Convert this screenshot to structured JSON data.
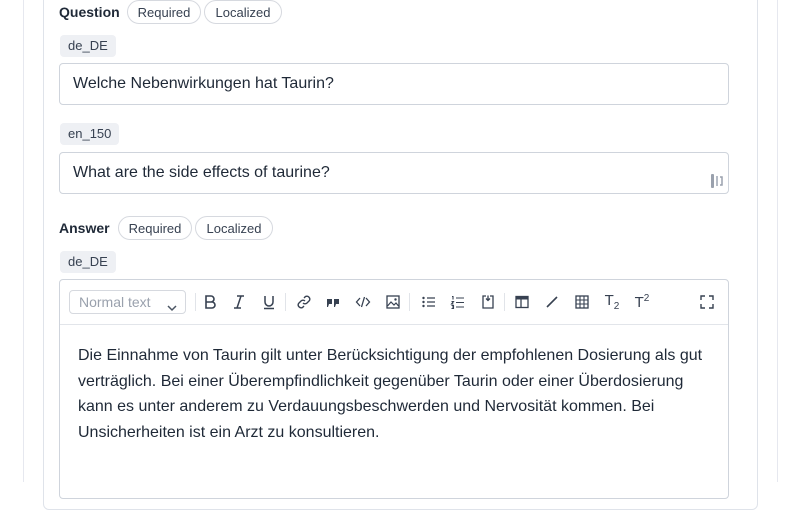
{
  "question": {
    "label": "Question",
    "badges": [
      "Required",
      "Localized"
    ],
    "locales": [
      {
        "code": "de_DE",
        "value": "Welche Nebenwirkungen hat Taurin?"
      },
      {
        "code": "en_150",
        "value": "What are the side effects of taurine?"
      }
    ]
  },
  "answer": {
    "label": "Answer",
    "badges": [
      "Required",
      "Localized"
    ],
    "locale": "de_DE",
    "editor": {
      "style_select": "Normal text",
      "subscript_label": "T",
      "subscript_mark": "2",
      "superscript_label": "T",
      "superscript_mark": "2",
      "content": "Die Einnahme von Taurin gilt unter Berücksichtigung der empfohlenen Dosierung als gut verträglich. Bei einer Überempfindlichkeit gegenüber Taurin oder einer Überdosierung kann es unter anderem zu Verdauungsbeschwerden und Nervosität kommen. Bei Unsicherheiten ist ein Arzt zu konsultieren."
    }
  }
}
